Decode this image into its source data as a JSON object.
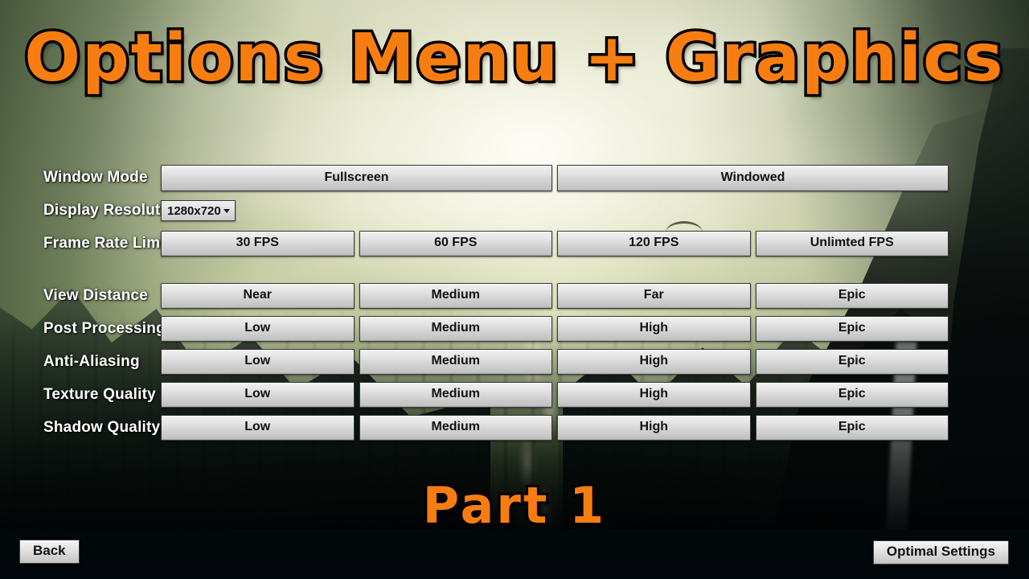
{
  "screen": {
    "title": "Options Menu + Graphics",
    "subtitle": "Part 1",
    "accent_color": "#f87d11",
    "title_outline_color": "#000000",
    "label_color": "#ffffff",
    "button_text_color": "#111111"
  },
  "settings": {
    "rows": [
      {
        "label": "Window Mode",
        "control": "buttons",
        "options": [
          "Fullscreen",
          "Windowed"
        ]
      },
      {
        "label": "Display Resolution",
        "control": "dropdown",
        "value": "1280x720",
        "caret_icon": "chevron-down-icon"
      },
      {
        "label": "Frame Rate Limit",
        "control": "buttons",
        "options": [
          "30 FPS",
          "60 FPS",
          "120 FPS",
          "Unlimted FPS"
        ]
      },
      {
        "label": "View Distance",
        "control": "buttons",
        "options": [
          "Near",
          "Medium",
          "Far",
          "Epic"
        ]
      },
      {
        "label": "Post Processing",
        "control": "buttons",
        "options": [
          "Low",
          "Medium",
          "High",
          "Epic"
        ]
      },
      {
        "label": "Anti-Aliasing",
        "control": "buttons",
        "options": [
          "Low",
          "Medium",
          "High",
          "Epic"
        ]
      },
      {
        "label": "Texture Quality",
        "control": "buttons",
        "options": [
          "Low",
          "Medium",
          "High",
          "Epic"
        ]
      },
      {
        "label": "Shadow Quality",
        "control": "buttons",
        "options": [
          "Low",
          "Medium",
          "High",
          "Epic"
        ]
      }
    ]
  },
  "footer": {
    "back_label": "Back",
    "optimal_label": "Optimal Settings"
  }
}
